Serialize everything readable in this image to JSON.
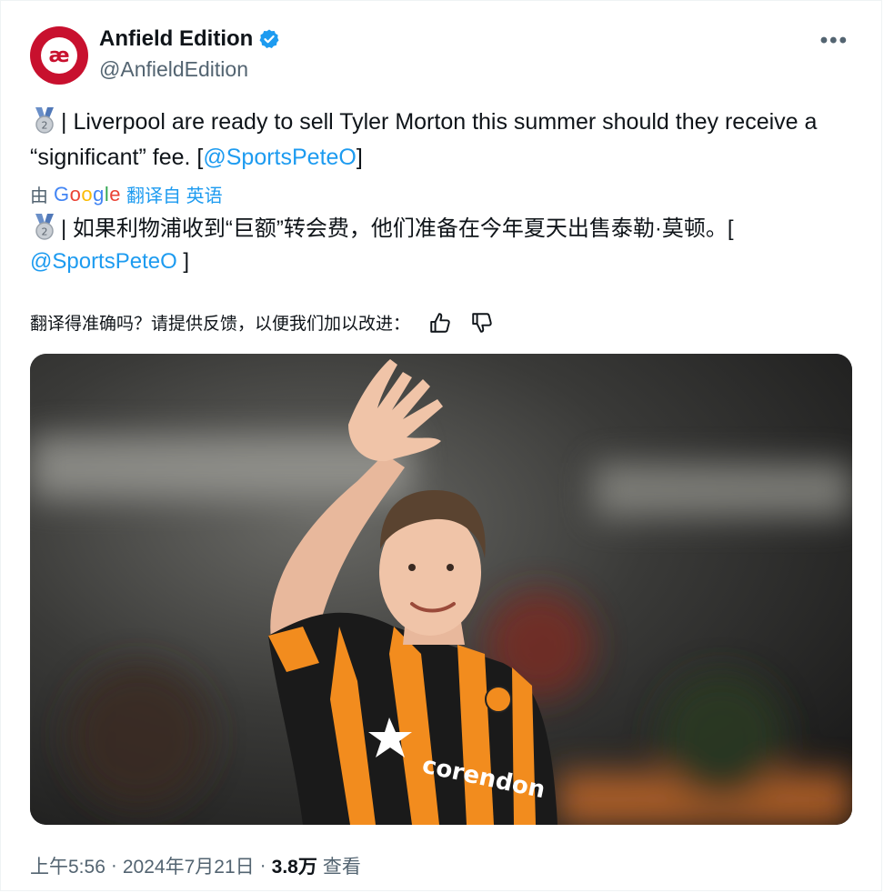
{
  "tweet": {
    "display_name": "Anfield Edition",
    "handle": "@AnfieldEdition",
    "avatar_text": "æ",
    "more_label": "•••",
    "text_main": "| Liverpool are ready to sell Tyler Morton this summer should they receive a “significant” fee. [",
    "mention": "@SportsPeteO",
    "text_end": "]",
    "translated_by_prefix": "由",
    "google": "Google",
    "translate_label": "翻译自 英语",
    "translated_main": "| 如果利物浦收到“巨额”转会费，他们准备在今年夏天出售泰勒·莫顿。[",
    "translated_mention": "@SportsPeteO",
    "translated_end": " ]",
    "feedback_prompt": "翻译得准确吗？请提供反馈，以便我们加以改进：",
    "time": "上午5:56",
    "separator": "·",
    "date": "2024年7月21日",
    "views_count": "3.8万",
    "views_label": "查看",
    "medal_number": "2"
  },
  "colors": {
    "link": "#1d9bf0",
    "avatar_bg": "#c8102e",
    "kit_orange": "#f28c1e",
    "kit_black": "#1a1a1a"
  },
  "icons": [
    "verified-badge-icon",
    "more-options-icon",
    "silver-medal-icon",
    "thumbs-up-icon",
    "thumbs-down-icon"
  ]
}
